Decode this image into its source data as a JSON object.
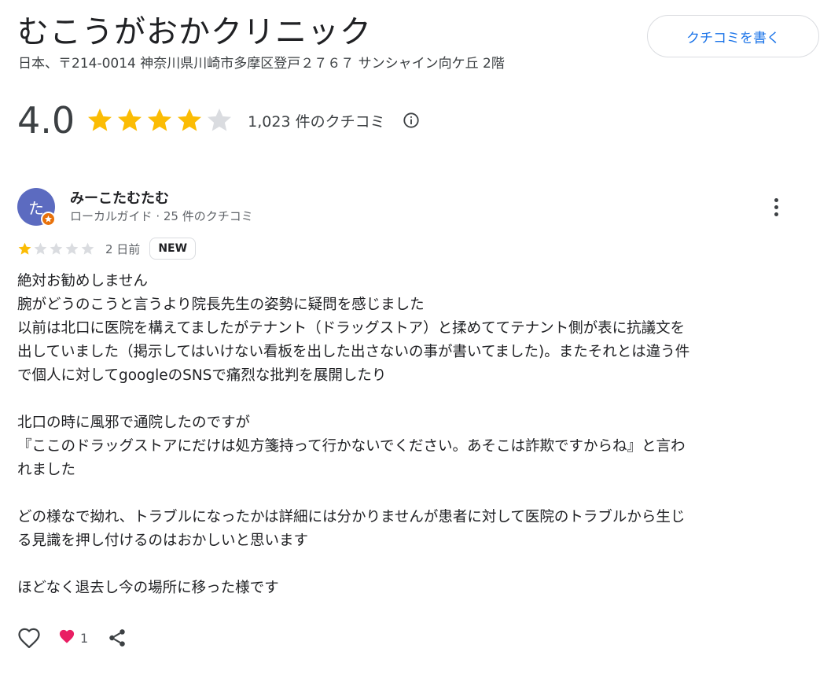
{
  "place": {
    "name": "むこうがおかクリニック",
    "address": "日本、〒214-0014 神奈川県川崎市多摩区登戸２７６７ サンシャイン向ケ丘 2階",
    "write_review_label": "クチコミを書く"
  },
  "summary": {
    "rating": "4.0",
    "rating_stars": 4,
    "review_count": "1,023 件のクチコミ",
    "star_color": "#fbbc04",
    "empty_star_color": "#dadce0"
  },
  "review": {
    "avatar_initial": "た",
    "reviewer_name": "みーこたむたむ",
    "reviewer_meta": "ローカルガイド · 25 件のクチコミ",
    "stars": 1,
    "date": "2 日前",
    "badge": "NEW",
    "lines": [
      "絶対お勧めしません",
      "腕がどうのこうと言うより院長先生の姿勢に疑問を感じました",
      "以前は北口に医院を構えてましたがテナント（ドラッグストア）と揉めててテナント側が表に抗議文を",
      "出していました（掲示してはいけない看板を出した出さないの事が書いてました)。またそれとは違う件",
      "で個人に対してgoogleのSNSで痛烈な批判を展開したり",
      "",
      "北口の時に風邪で通院したのですが",
      "『ここのドラッグストアにだけは処方箋持って行かないでください。あそこは詐欺ですからね』と言わ",
      "れました",
      "",
      "どの様なで拗れ、トラブルになったかは詳細には分かりませんが患者に対して医院のトラブルから生じ",
      "る見識を押し付けるのはおかしいと思います",
      "",
      "ほどなく退去し今の場所に移った様です"
    ],
    "reaction_count": "1",
    "icons": {
      "like": "heart-outline-icon",
      "reaction": "heart-filled-icon",
      "share": "share-icon",
      "more": "more-vert-icon",
      "info": "info-icon",
      "badge": "local-guide-badge-icon"
    }
  }
}
